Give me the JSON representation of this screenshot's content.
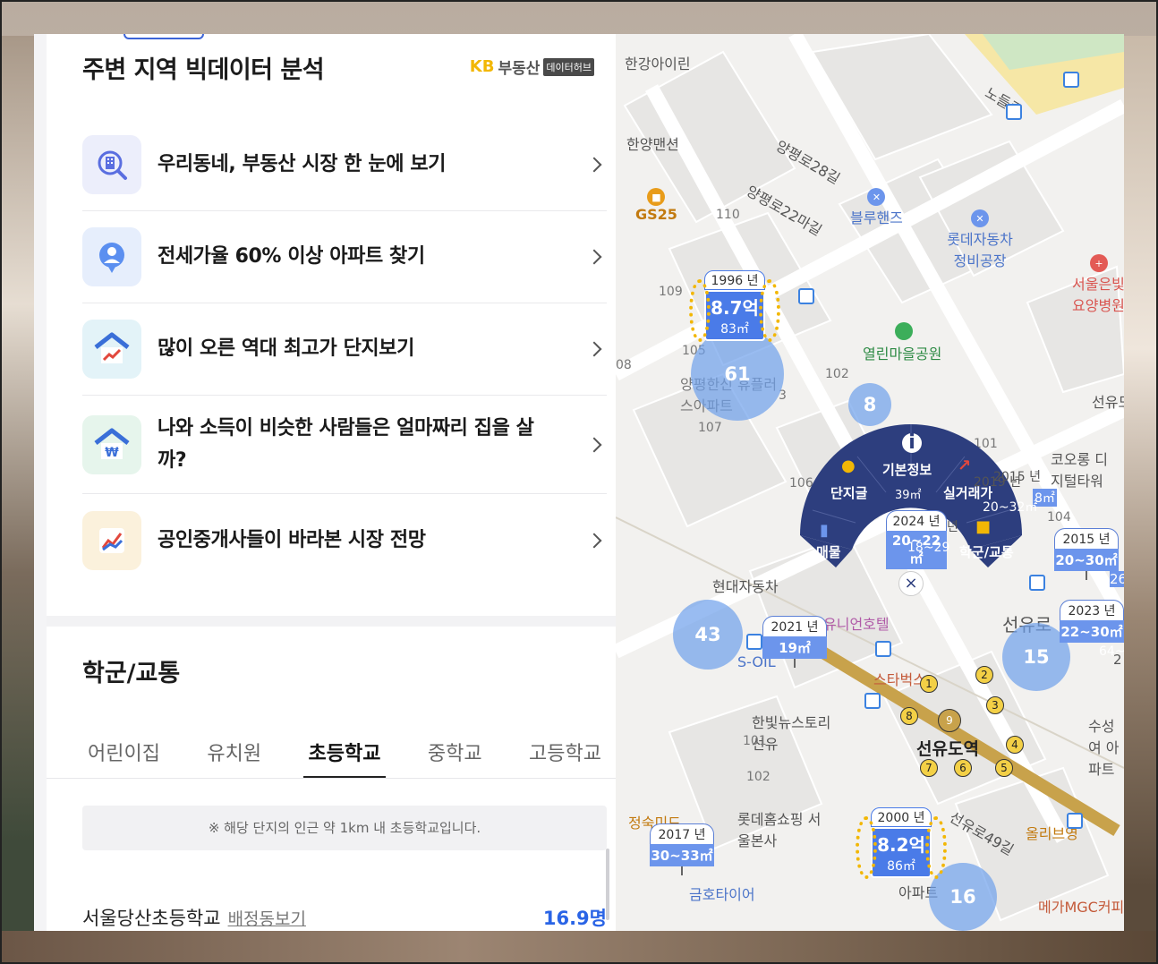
{
  "panel": {
    "section_title": "주변 지역 빅데이터 분석",
    "logo": {
      "kb": "KB",
      "brand": "부동산",
      "hub": "데이터허브"
    },
    "menu": [
      {
        "label": "우리동네, 부동산 시장 한 눈에 보기",
        "icon": "building-search-icon",
        "bg": "#eceefb"
      },
      {
        "label": "전세가율 60% 이상 아파트 찾기",
        "icon": "person-bubble-icon",
        "bg": "#e6eefc"
      },
      {
        "label": "많이 오른 역대 최고가 단지보기",
        "icon": "house-chart-icon",
        "bg": "#e3f3f8"
      },
      {
        "label": "나와 소득이 비슷한 사람들은 얼마짜리 집을 살까?",
        "icon": "house-won-icon",
        "bg": "#e6f5ec"
      },
      {
        "label": "공인중개사들이 바라본 시장 전망",
        "icon": "trend-chart-icon",
        "bg": "#fbf1dc"
      }
    ],
    "school_section": {
      "title": "학군/교통",
      "tabs": [
        "어린이집",
        "유치원",
        "초등학교",
        "중학교",
        "고등학교"
      ],
      "active_tab": "초등학교",
      "notice": "※ 해당 단지의 인근 약 1km 내 초등학교입니다.",
      "school": {
        "name": "서울당산초등학교",
        "link": "배정동보기",
        "count": "16.9명"
      }
    }
  },
  "map": {
    "top_labels": [
      "한강아이린",
      "한양맨션",
      "GS25",
      "블루핸즈",
      "롯데자동차 정비공장",
      "열린마을공원",
      "서울은빛 요양병원",
      "선유도",
      "코오롱 디지털타워",
      "현대자동차",
      "유니언호텔",
      "S-OIL",
      "한빛뉴스토리 선유",
      "선유도역",
      "롯데홈쇼핑 서울본사",
      "정숙미드",
      "금호타이어",
      "올리브영",
      "메가MGC커피",
      "스타벅스",
      "수성여 아파트",
      "양평한신 휴플러스아파트",
      "노들로",
      "양평로28길",
      "양평로22마길",
      "선유로",
      "선유로49길",
      "아파트"
    ],
    "block_numbers": [
      "110",
      "109",
      "105",
      "102",
      "101",
      "107",
      "106",
      "104",
      "101",
      "102",
      "08",
      "3"
    ],
    "clusters": [
      {
        "count": "61"
      },
      {
        "count": "8"
      },
      {
        "count": "43"
      },
      {
        "count": "15"
      },
      {
        "count": "16"
      }
    ],
    "gold_markers": [
      {
        "year": "1996 년",
        "price": "8.7억",
        "area": "83㎡"
      },
      {
        "year": "2000 년",
        "price": "8.2억",
        "area": "86㎡"
      }
    ],
    "apt_markers": [
      {
        "year": "2024 년",
        "size": "20~22㎡"
      },
      {
        "year": "2021 년",
        "size": "19㎡"
      },
      {
        "year": "2017 년",
        "size": "30~33㎡"
      },
      {
        "year": "2015 년",
        "size": "20~30㎡"
      },
      {
        "year": "2023 년",
        "size": "22~30㎡"
      }
    ],
    "radial_menu": {
      "info": "기본정보",
      "chat": "단지글",
      "deal": "실거래가",
      "listing": "매물",
      "school": "학군/교통",
      "close": "×"
    },
    "station_exits": [
      "1",
      "2",
      "3",
      "4",
      "5",
      "6",
      "7",
      "8",
      "9"
    ],
    "partial_markers": [
      "39㎡",
      "2019 년",
      "2015 년",
      "8㎡",
      "20~32㎡",
      "18~29",
      "년",
      "26",
      "64~",
      "2"
    ]
  }
}
